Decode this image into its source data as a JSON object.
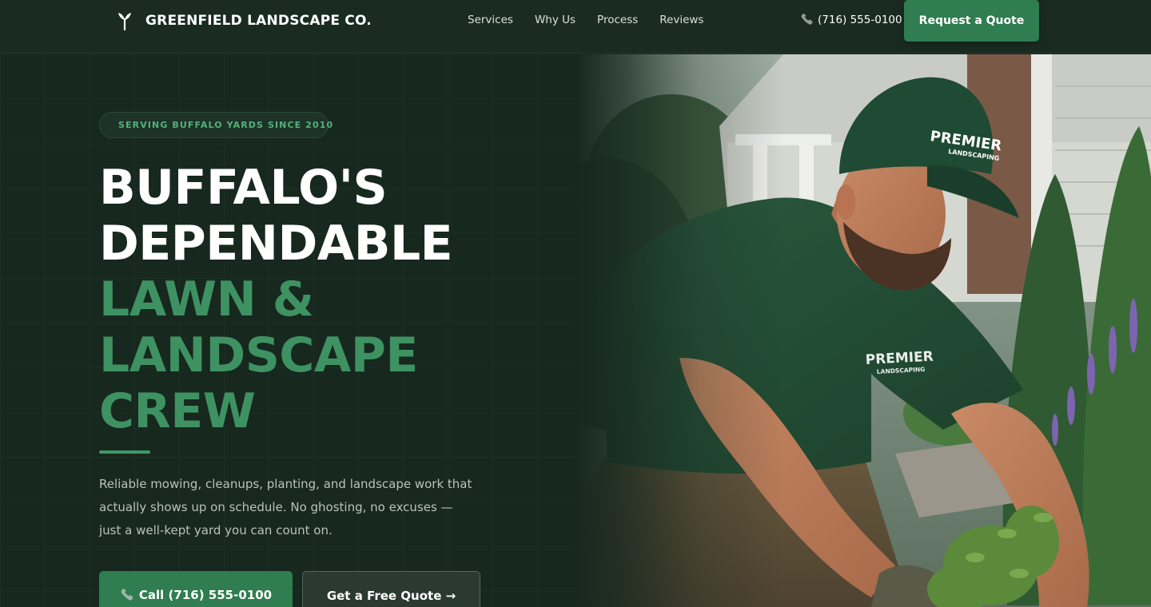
{
  "brand": {
    "name": "GREENFIELD LANDSCAPE CO.",
    "logo_icon": "sprout-icon"
  },
  "nav": {
    "links": [
      "Services",
      "Why Us",
      "Process",
      "Reviews"
    ],
    "phone": "(716) 555-0100",
    "cta_label": "Request a Quote"
  },
  "hero": {
    "badge": "SERVING BUFFALO YARDS SINCE 2010",
    "headline_white": [
      "BUFFALO'S",
      "DEPENDABLE"
    ],
    "headline_green": [
      "LAWN &",
      "LANDSCAPE",
      "CREW"
    ],
    "subtext": "Reliable mowing, cleanups, planting, and landscape work that actually shows up on schedule. No ghosting, no excuses — just a well-kept yard you can count on.",
    "call_button_label": "Call (716) 555-0100",
    "quote_button_label": "Get a Free Quote →",
    "photo": {
      "cap_text": "PREMIER",
      "cap_subtext": "LANDSCAPING",
      "shirt_text": "PREMIER",
      "shirt_subtext": "LANDSCAPING"
    }
  },
  "colors": {
    "background": "#17281f",
    "nav_background": "#1a2c22",
    "accent_green": "#2f7d50",
    "headline_green": "#3e9262",
    "badge_text": "#56b07a",
    "body_text": "#b7c4bc"
  }
}
